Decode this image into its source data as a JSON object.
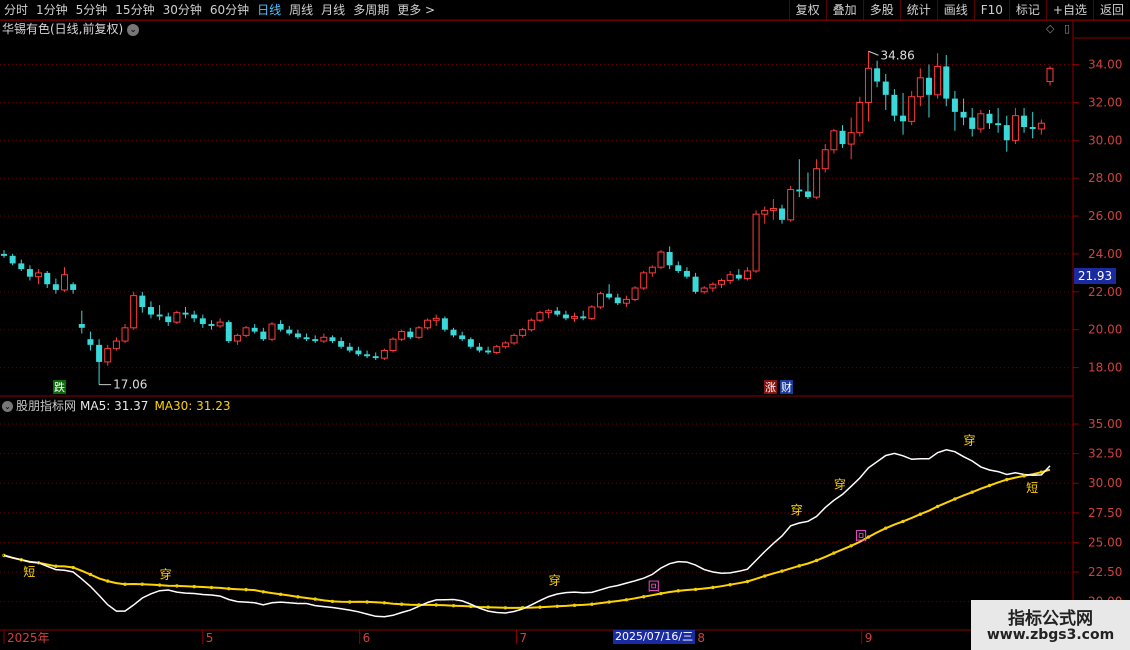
{
  "toolbar": {
    "left_items": [
      "分时",
      "1分钟",
      "5分钟",
      "15分钟",
      "30分钟",
      "60分钟",
      "日线",
      "周线",
      "月线",
      "多周期",
      "更多 >"
    ],
    "active_index": 6,
    "right_items": [
      "复权",
      "叠加",
      "多股",
      "统计",
      "画线",
      "F10",
      "标记",
      "+自选",
      "返回"
    ]
  },
  "chart_title": "华锡有色(日线,前复权)",
  "chart_title_chev": "⌄",
  "indicator": {
    "name": "股朋指标网",
    "ma5_label": "MA5: 31.37",
    "ma30_label": "MA30: 31.23"
  },
  "price_tag": "21.93",
  "date_tag": "2025/07/16/三",
  "watermark": {
    "title": "指标公式网",
    "url": "www.zbgs3.com"
  },
  "colors": {
    "up": "#ff3b3b",
    "down": "#3ad8d8",
    "ma5": "#ffffff",
    "ma30": "#ffd400",
    "grid": "#6a0000"
  },
  "chart_data": {
    "type": "candlestick",
    "main_axis": {
      "y_ticks": [
        "34.00",
        "32.00",
        "30.00",
        "28.00",
        "26.00",
        "24.00",
        "22.00",
        "20.00",
        "18.00"
      ],
      "ylim": [
        16.5,
        35.4
      ]
    },
    "sub_axis": {
      "y_ticks": [
        "35.00",
        "32.50",
        "30.00",
        "27.50",
        "25.00",
        "22.50",
        "20.00"
      ],
      "ylim": [
        17.6,
        37.2
      ]
    },
    "x_ticks": [
      "2025年",
      "5",
      "6",
      "7",
      "8",
      "9"
    ],
    "annotations": {
      "high_label": "34.86",
      "low_label": "17.06",
      "drop_marker": "跌",
      "rise_marker": "涨",
      "finance_marker": "财"
    },
    "signal_labels": {
      "short": "短",
      "cross": "穿",
      "back": "回"
    },
    "candles": [
      [
        24.0,
        24.2,
        23.8,
        23.9
      ],
      [
        23.9,
        24.0,
        23.4,
        23.5
      ],
      [
        23.5,
        23.7,
        23.1,
        23.2
      ],
      [
        23.2,
        23.4,
        22.6,
        22.8
      ],
      [
        22.8,
        23.2,
        22.4,
        23.0
      ],
      [
        23.0,
        23.1,
        22.2,
        22.4
      ],
      [
        22.4,
        22.7,
        21.9,
        22.1
      ],
      [
        22.1,
        23.3,
        22.0,
        22.9
      ],
      [
        22.4,
        22.5,
        21.9,
        22.1
      ],
      [
        20.3,
        21.0,
        19.8,
        20.1
      ],
      [
        19.5,
        19.9,
        18.9,
        19.2
      ],
      [
        19.2,
        19.5,
        17.1,
        18.3
      ],
      [
        18.3,
        19.2,
        18.1,
        19.0
      ],
      [
        19.0,
        19.6,
        18.9,
        19.4
      ],
      [
        19.4,
        20.3,
        19.3,
        20.1
      ],
      [
        20.1,
        22.0,
        20.0,
        21.8
      ],
      [
        21.8,
        22.0,
        20.9,
        21.2
      ],
      [
        21.2,
        21.5,
        20.6,
        20.8
      ],
      [
        20.8,
        21.3,
        20.5,
        20.7
      ],
      [
        20.7,
        20.9,
        20.2,
        20.4
      ],
      [
        20.4,
        21.0,
        20.3,
        20.9
      ],
      [
        20.9,
        21.2,
        20.6,
        20.8
      ],
      [
        20.8,
        21.0,
        20.4,
        20.6
      ],
      [
        20.6,
        20.8,
        20.1,
        20.3
      ],
      [
        20.3,
        20.5,
        20.0,
        20.2
      ],
      [
        20.2,
        20.6,
        20.1,
        20.4
      ],
      [
        20.4,
        20.5,
        19.3,
        19.4
      ],
      [
        19.4,
        19.8,
        19.2,
        19.7
      ],
      [
        19.7,
        20.2,
        19.6,
        20.1
      ],
      [
        20.1,
        20.3,
        19.8,
        19.9
      ],
      [
        19.9,
        20.1,
        19.4,
        19.5
      ],
      [
        19.5,
        20.4,
        19.4,
        20.3
      ],
      [
        20.3,
        20.5,
        19.9,
        20.0
      ],
      [
        20.0,
        20.2,
        19.7,
        19.8
      ],
      [
        19.8,
        20.0,
        19.5,
        19.6
      ],
      [
        19.6,
        19.8,
        19.4,
        19.5
      ],
      [
        19.5,
        19.7,
        19.3,
        19.4
      ],
      [
        19.4,
        19.8,
        19.3,
        19.6
      ],
      [
        19.6,
        19.7,
        19.3,
        19.4
      ],
      [
        19.4,
        19.6,
        19.0,
        19.1
      ],
      [
        19.1,
        19.3,
        18.8,
        18.9
      ],
      [
        18.9,
        19.1,
        18.6,
        18.7
      ],
      [
        18.7,
        18.9,
        18.5,
        18.6
      ],
      [
        18.6,
        18.8,
        18.4,
        18.5
      ],
      [
        18.5,
        19.0,
        18.4,
        18.9
      ],
      [
        18.9,
        19.6,
        18.8,
        19.5
      ],
      [
        19.5,
        20.0,
        19.4,
        19.9
      ],
      [
        19.9,
        20.1,
        19.5,
        19.6
      ],
      [
        19.6,
        20.2,
        19.5,
        20.1
      ],
      [
        20.1,
        20.6,
        20.0,
        20.5
      ],
      [
        20.5,
        20.8,
        20.2,
        20.6
      ],
      [
        20.6,
        20.7,
        19.9,
        20.0
      ],
      [
        20.0,
        20.1,
        19.6,
        19.7
      ],
      [
        19.7,
        19.9,
        19.4,
        19.5
      ],
      [
        19.5,
        19.6,
        19.0,
        19.1
      ],
      [
        19.1,
        19.3,
        18.8,
        18.9
      ],
      [
        18.9,
        19.1,
        18.7,
        18.8
      ],
      [
        18.8,
        19.2,
        18.7,
        19.1
      ],
      [
        19.1,
        19.4,
        19.0,
        19.3
      ],
      [
        19.3,
        19.8,
        19.2,
        19.7
      ],
      [
        19.7,
        20.1,
        19.6,
        20.0
      ],
      [
        20.0,
        20.6,
        19.9,
        20.5
      ],
      [
        20.5,
        21.0,
        20.4,
        20.9
      ],
      [
        20.9,
        21.1,
        20.6,
        21.0
      ],
      [
        21.0,
        21.2,
        20.7,
        20.8
      ],
      [
        20.8,
        21.0,
        20.5,
        20.6
      ],
      [
        20.6,
        20.9,
        20.4,
        20.7
      ],
      [
        20.7,
        21.0,
        20.5,
        20.6
      ],
      [
        20.6,
        21.3,
        20.5,
        21.2
      ],
      [
        21.2,
        22.0,
        21.1,
        21.9
      ],
      [
        21.9,
        22.4,
        21.6,
        21.7
      ],
      [
        21.7,
        21.9,
        21.3,
        21.4
      ],
      [
        21.4,
        21.8,
        21.2,
        21.6
      ],
      [
        21.6,
        22.3,
        21.5,
        22.2
      ],
      [
        22.2,
        23.1,
        22.1,
        23.0
      ],
      [
        23.0,
        23.4,
        22.8,
        23.3
      ],
      [
        23.3,
        24.2,
        23.2,
        24.1
      ],
      [
        24.1,
        24.4,
        23.2,
        23.4
      ],
      [
        23.4,
        23.6,
        23.0,
        23.1
      ],
      [
        23.1,
        23.3,
        22.7,
        22.8
      ],
      [
        22.8,
        23.0,
        21.9,
        22.0
      ],
      [
        22.0,
        22.3,
        21.9,
        22.2
      ],
      [
        22.2,
        22.5,
        22.0,
        22.4
      ],
      [
        22.4,
        22.7,
        22.2,
        22.6
      ],
      [
        22.6,
        23.1,
        22.4,
        22.9
      ],
      [
        22.9,
        23.2,
        22.6,
        22.7
      ],
      [
        22.7,
        23.3,
        22.6,
        23.1
      ],
      [
        23.1,
        26.3,
        23.0,
        26.1
      ],
      [
        26.1,
        26.5,
        25.6,
        26.3
      ],
      [
        26.3,
        26.9,
        25.8,
        26.4
      ],
      [
        26.4,
        26.6,
        25.6,
        25.8
      ],
      [
        25.8,
        27.6,
        25.7,
        27.4
      ],
      [
        27.4,
        29.0,
        27.0,
        27.3
      ],
      [
        27.3,
        28.3,
        26.9,
        27.0
      ],
      [
        27.0,
        29.0,
        26.9,
        28.5
      ],
      [
        28.5,
        29.8,
        28.3,
        29.5
      ],
      [
        29.5,
        30.6,
        29.3,
        30.5
      ],
      [
        30.5,
        30.8,
        29.6,
        29.8
      ],
      [
        29.8,
        31.2,
        29.0,
        30.4
      ],
      [
        30.4,
        32.3,
        30.2,
        32.0
      ],
      [
        32.0,
        34.7,
        31.0,
        33.8
      ],
      [
        33.8,
        34.2,
        32.8,
        33.1
      ],
      [
        33.1,
        33.5,
        31.6,
        32.4
      ],
      [
        32.4,
        32.7,
        31.0,
        31.3
      ],
      [
        31.3,
        32.5,
        30.3,
        31.0
      ],
      [
        31.0,
        32.6,
        30.8,
        32.3
      ],
      [
        32.3,
        33.8,
        31.8,
        33.3
      ],
      [
        33.3,
        34.0,
        31.2,
        32.4
      ],
      [
        32.4,
        34.6,
        32.2,
        33.9
      ],
      [
        33.9,
        34.5,
        31.8,
        32.2
      ],
      [
        32.2,
        32.6,
        30.5,
        31.5
      ],
      [
        31.5,
        32.2,
        30.8,
        31.2
      ],
      [
        31.2,
        31.7,
        30.2,
        30.6
      ],
      [
        30.6,
        31.6,
        30.4,
        31.4
      ],
      [
        31.4,
        31.6,
        30.6,
        30.9
      ],
      [
        30.9,
        31.7,
        30.4,
        30.8
      ],
      [
        30.8,
        31.3,
        29.4,
        30.0
      ],
      [
        30.0,
        31.7,
        29.8,
        31.3
      ],
      [
        31.3,
        31.7,
        30.4,
        30.7
      ],
      [
        30.7,
        31.5,
        30.1,
        30.6
      ],
      [
        30.6,
        31.1,
        30.3,
        30.9
      ],
      [
        33.1,
        33.9,
        32.9,
        33.8
      ]
    ]
  }
}
